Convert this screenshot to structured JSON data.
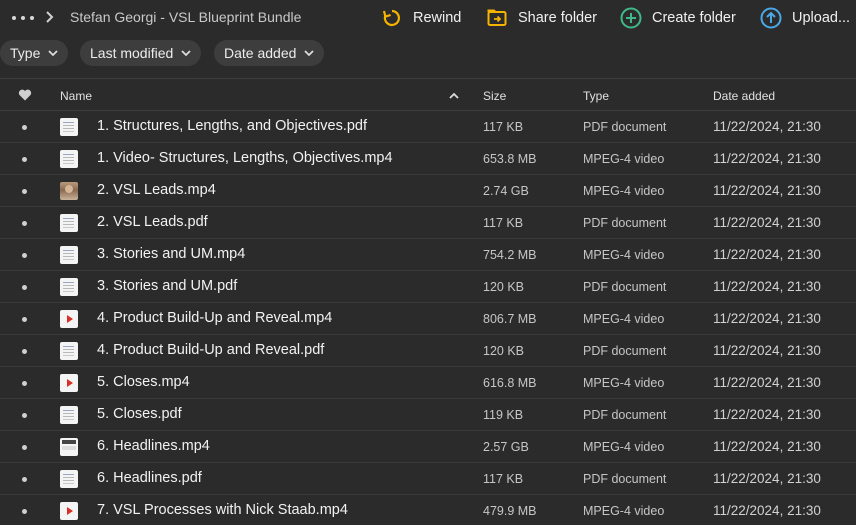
{
  "header": {
    "title": "Stefan Georgi - VSL Blueprint Bundle",
    "actions": {
      "rewind": "Rewind",
      "share": "Share folder",
      "create": "Create folder",
      "upload": "Upload..."
    }
  },
  "filters": {
    "type": "Type",
    "last_modified": "Last modified",
    "date_added": "Date added"
  },
  "columns": {
    "name": "Name",
    "size": "Size",
    "type": "Type",
    "date_added": "Date added"
  },
  "colors": {
    "accent_yellow": "#f5b400",
    "accent_green": "#3fb98a",
    "accent_blue": "#4aa8e8"
  },
  "rows": [
    {
      "name": "1. Structures, Lengths, and Objectives.pdf",
      "size": "117 KB",
      "type": "PDF document",
      "date": "11/22/2024, 21:30",
      "thumb": "doc"
    },
    {
      "name": "1. Video- Structures, Lengths, Objectives.mp4",
      "size": "653.8 MB",
      "type": "MPEG-4 video",
      "date": "11/22/2024, 21:30",
      "thumb": "doc"
    },
    {
      "name": "2. VSL Leads.mp4",
      "size": "2.74 GB",
      "type": "MPEG-4 video",
      "date": "11/22/2024, 21:30",
      "thumb": "photo"
    },
    {
      "name": "2. VSL Leads.pdf",
      "size": "117 KB",
      "type": "PDF document",
      "date": "11/22/2024, 21:30",
      "thumb": "doc"
    },
    {
      "name": "3. Stories and UM.mp4",
      "size": "754.2 MB",
      "type": "MPEG-4 video",
      "date": "11/22/2024, 21:30",
      "thumb": "doc"
    },
    {
      "name": "3. Stories and UM.pdf",
      "size": "120 KB",
      "type": "PDF document",
      "date": "11/22/2024, 21:30",
      "thumb": "doc"
    },
    {
      "name": "4. Product Build-Up and Reveal.mp4",
      "size": "806.7 MB",
      "type": "MPEG-4 video",
      "date": "11/22/2024, 21:30",
      "thumb": "play"
    },
    {
      "name": "4. Product Build-Up and Reveal.pdf",
      "size": "120 KB",
      "type": "PDF document",
      "date": "11/22/2024, 21:30",
      "thumb": "doc"
    },
    {
      "name": "5. Closes.mp4",
      "size": "616.8 MB",
      "type": "MPEG-4 video",
      "date": "11/22/2024, 21:30",
      "thumb": "play"
    },
    {
      "name": "5. Closes.pdf",
      "size": "119 KB",
      "type": "PDF document",
      "date": "11/22/2024, 21:30",
      "thumb": "doc"
    },
    {
      "name": "6. Headlines.mp4",
      "size": "2.57 GB",
      "type": "MPEG-4 video",
      "date": "11/22/2024, 21:30",
      "thumb": "frame"
    },
    {
      "name": "6. Headlines.pdf",
      "size": "117 KB",
      "type": "PDF document",
      "date": "11/22/2024, 21:30",
      "thumb": "doc"
    },
    {
      "name": "7. VSL Processes with Nick Staab.mp4",
      "size": "479.9 MB",
      "type": "MPEG-4 video",
      "date": "11/22/2024, 21:30",
      "thumb": "play"
    }
  ]
}
